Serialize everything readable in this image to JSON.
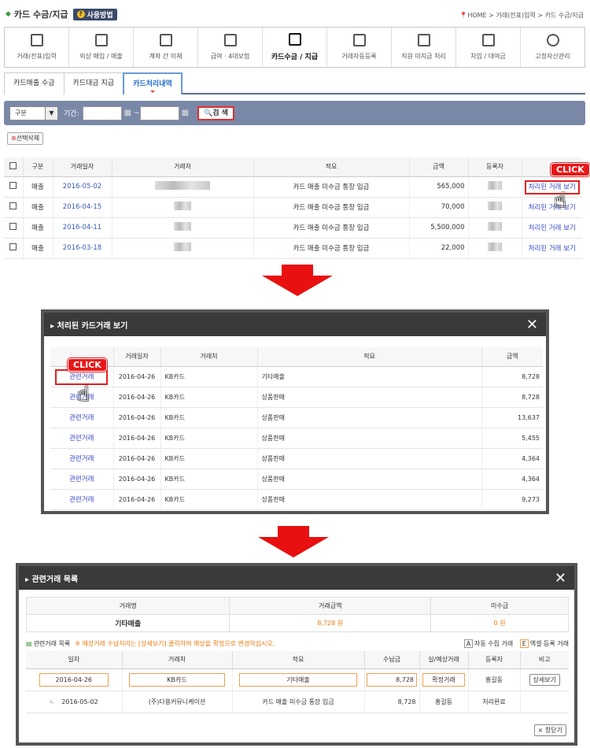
{
  "header": {
    "title": "카드 수금/지급",
    "help_label": "사용방법",
    "breadcrumb": "HOME > 거래(전표)입력 > 카드 수금/지급"
  },
  "main_nav": [
    "거래(전표)입력",
    "외상 매입 / 매출",
    "계좌 간 이체",
    "급여 · 4대보험",
    "카드수금 / 지급",
    "거래자동등록",
    "직원 미지급 처리",
    "차입 / 대여금",
    "고정자산관리"
  ],
  "sub_tabs": [
    "카드매출 수금",
    "카드대금 지급",
    "카드처리내역"
  ],
  "filter": {
    "type_select": "구분",
    "period_label": "기간:",
    "date_separator": "~",
    "search_label": "검 색"
  },
  "delete_selected_label": "선택삭제",
  "main_table": {
    "headers": [
      "구분",
      "거래일자",
      "거래처",
      "적요",
      "금액",
      "등록자",
      "거래"
    ],
    "rows": [
      {
        "type": "매출",
        "date": "2016-05-02",
        "memo": "카드 매출 미수금 통장 입금",
        "amount": "565,000",
        "action": "처리된 거래 보기"
      },
      {
        "type": "매출",
        "date": "2016-04-15",
        "memo": "카드 매출 미수금 통장 입금",
        "amount": "70,000",
        "action": "처리된 거래 보기"
      },
      {
        "type": "매출",
        "date": "2016-04-11",
        "memo": "카드 매출 미수금 통장 입금",
        "amount": "5,500,000",
        "action": "처리된 거래 보기"
      },
      {
        "type": "매출",
        "date": "2016-03-18",
        "memo": "카드 매출 미수금 통장 입금",
        "amount": "22,000",
        "action": "처리된 거래 보기"
      }
    ]
  },
  "click_label": "CLICK",
  "popup1": {
    "title": "처리된 카드거래 보기",
    "headers": [
      "",
      "거래일자",
      "거래처",
      "적요",
      "금액"
    ],
    "rows": [
      {
        "link": "관련거래",
        "date": "2016-04-26",
        "vendor": "KB카드",
        "memo": "기타매출",
        "amount": "8,728"
      },
      {
        "link": "관련거래",
        "date": "2016-04-26",
        "vendor": "KB카드",
        "memo": "상품판매",
        "amount": "8,728"
      },
      {
        "link": "관련거래",
        "date": "2016-04-26",
        "vendor": "KB카드",
        "memo": "상품판매",
        "amount": "13,637"
      },
      {
        "link": "관련거래",
        "date": "2016-04-26",
        "vendor": "KB카드",
        "memo": "상품판매",
        "amount": "5,455"
      },
      {
        "link": "관련거래",
        "date": "2016-04-26",
        "vendor": "KB카드",
        "memo": "상품판매",
        "amount": "4,364"
      },
      {
        "link": "관련거래",
        "date": "2016-04-26",
        "vendor": "KB카드",
        "memo": "상품판매",
        "amount": "4,364"
      },
      {
        "link": "관련거래",
        "date": "2016-04-26",
        "vendor": "KB카드",
        "memo": "상품판매",
        "amount": "9,273"
      }
    ]
  },
  "popup2": {
    "title": "관련거래 목록",
    "summary_headers": [
      "거래명",
      "거래금액",
      "미수금"
    ],
    "summary_values": [
      "기타매출",
      "8,728 원",
      "0 원"
    ],
    "list_title": "관련거래 목록",
    "notice": "※ 예상거래 수납처리는 [상세보기] 클릭하여 예상을 확정으로 변경하십시오.",
    "legend_auto": "자동 수집 거래",
    "legend_excel": "엑셀 등록 거래",
    "legend_auto_tag": "A",
    "legend_excel_tag": "E",
    "headers": [
      "일자",
      "거래처",
      "적요",
      "수납금",
      "실/예상거래",
      "등록자",
      "비고"
    ],
    "row1": {
      "date": "2016-04-26",
      "vendor": "KB카드",
      "memo": "기타매출",
      "amount": "8,728",
      "kind": "확정거래",
      "user": "홍길동",
      "btn": "상세보기"
    },
    "row2": {
      "mark": "ㄴ",
      "date": "2016-05-02",
      "vendor": "(주)다용커뮤니케이션",
      "memo": "카드 매출 미수금 통장 입금",
      "amount": "8,728",
      "kind": "홍길동",
      "user": "처리완료"
    },
    "close_label": "창닫기"
  },
  "colors": {
    "accent": "#e81818",
    "nav_bar": "#7a88a8",
    "link": "#3a5ab8",
    "orange": "#f07a10"
  }
}
